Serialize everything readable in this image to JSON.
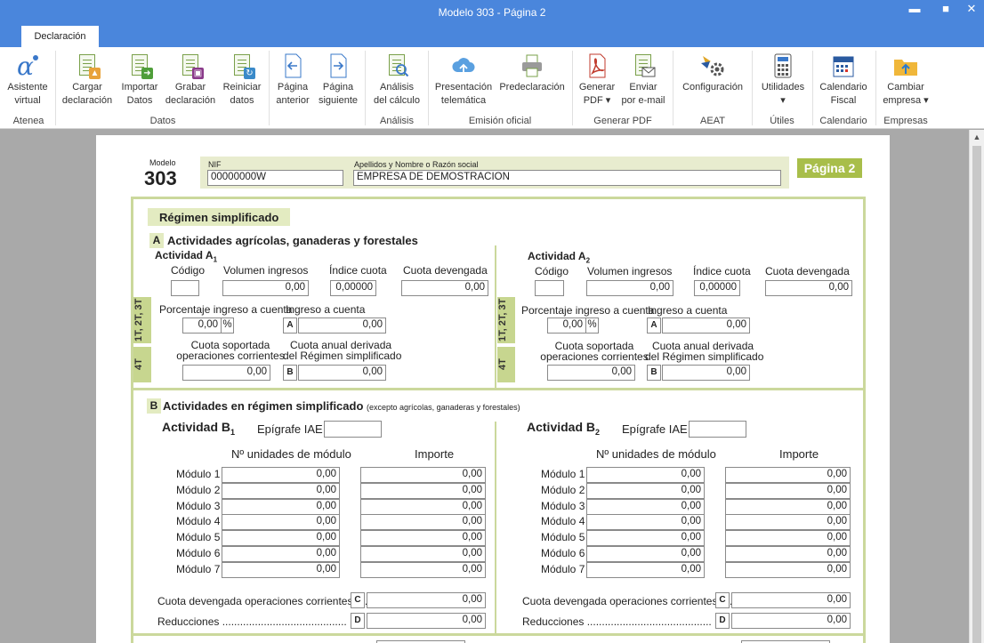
{
  "window": {
    "title": "Modelo 303 - Página 2",
    "controls": {
      "minimize": "▬",
      "maximize": "■",
      "close": "✕"
    }
  },
  "tabs": [
    {
      "label": "Declaración"
    }
  ],
  "ribbon": {
    "buttons": [
      {
        "id": "asistente",
        "label": "Asistente\nvirtual",
        "icon": "atenea-icon"
      },
      {
        "id": "cargar",
        "label": "Cargar\ndeclaración",
        "icon": "load-doc-icon"
      },
      {
        "id": "importar",
        "label": "Importar\nDatos",
        "icon": "import-doc-icon"
      },
      {
        "id": "grabar",
        "label": "Grabar\ndeclaración",
        "icon": "save-doc-icon"
      },
      {
        "id": "reiniciar",
        "label": "Reiniciar\ndatos",
        "icon": "reset-doc-icon"
      },
      {
        "id": "anterior",
        "label": "Página\nanterior",
        "icon": "prev-page-icon"
      },
      {
        "id": "siguiente",
        "label": "Página\nsiguiente",
        "icon": "next-page-icon"
      },
      {
        "id": "analisis",
        "label": "Análisis\ndel cálculo",
        "icon": "analysis-icon"
      },
      {
        "id": "presentacion",
        "label": "Presentación\ntelemática",
        "icon": "cloud-upload-icon"
      },
      {
        "id": "predeclaracion",
        "label": "Predeclaración",
        "icon": "printer-icon"
      },
      {
        "id": "generarpdf",
        "label": "Generar\nPDF ▾",
        "icon": "pdf-icon"
      },
      {
        "id": "enviar",
        "label": "Enviar\npor e-mail",
        "icon": "email-doc-icon"
      },
      {
        "id": "configuracion",
        "label": "Configuración",
        "icon": "gear-icon"
      },
      {
        "id": "utilidades",
        "label": "Utilidades\n▾",
        "icon": "calculator-icon"
      },
      {
        "id": "calendario",
        "label": "Calendario\nFiscal",
        "icon": "calendar-icon"
      },
      {
        "id": "cambiar",
        "label": "Cambiar\nempresa ▾",
        "icon": "folder-upload-icon"
      }
    ],
    "groups": [
      "Atenea",
      "Datos",
      "Análisis",
      "Emisión oficial",
      "Generar PDF",
      "AEAT",
      "Útiles",
      "Calendario",
      "Empresas"
    ]
  },
  "form": {
    "modelo_label": "Modelo",
    "modelo_num": "303",
    "nif_label": "NIF",
    "nif_value": "00000000W",
    "nombre_label": "Apellidos y Nombre o Razón social",
    "nombre_value": "EMPRESA DE DEMOSTRACION",
    "pagina": "Página 2",
    "regimen_title": "Régimen simplificado",
    "sectionA": {
      "letter": "A",
      "title": "Actividades agrícolas, ganaderas y forestales",
      "strip_top": "1T, 2T, 3T",
      "strip_bottom": "4T",
      "actividades": [
        {
          "title": "Actividad A",
          "sub": "1",
          "codigo_label": "Código",
          "codigo": "",
          "volumen_label": "Volumen ingresos",
          "volumen": "0,00",
          "indice_label": "Índice cuota",
          "indice": "0,00000",
          "cuota_label": "Cuota devengada",
          "cuota": "0,00",
          "porc_label": "Porcentaje ingreso a cuenta",
          "porc": "0,00",
          "pct": "%",
          "ingreso_label": "Ingreso a cuenta",
          "ingreso_letter": "A",
          "ingreso": "0,00",
          "soportada_label1": "Cuota soportada",
          "soportada_label2": "operaciones corrientes",
          "soportada": "0,00",
          "anual_label1": "Cuota anual derivada",
          "anual_label2": "del Régimen simplificado",
          "anual_letter": "B",
          "anual": "0,00"
        },
        {
          "title": "Actividad A",
          "sub": "2",
          "codigo_label": "Código",
          "codigo": "",
          "volumen_label": "Volumen ingresos",
          "volumen": "0,00",
          "indice_label": "Índice cuota",
          "indice": "0,00000",
          "cuota_label": "Cuota devengada",
          "cuota": "0,00",
          "porc_label": "Porcentaje ingreso a cuenta",
          "porc": "0,00",
          "pct": "%",
          "ingreso_label": "Ingreso a cuenta",
          "ingreso_letter": "A",
          "ingreso": "0,00",
          "soportada_label1": "Cuota soportada",
          "soportada_label2": "operaciones corrientes",
          "soportada": "0,00",
          "anual_label1": "Cuota anual derivada",
          "anual_label2": "del Régimen simplificado",
          "anual_letter": "B",
          "anual": "0,00"
        }
      ]
    },
    "sectionB": {
      "letter": "B",
      "title": "Actividades en régimen simplificado",
      "subtitle": "(excepto agrícolas, ganaderas y forestales)",
      "actividades": [
        {
          "title": "Actividad B",
          "sub": "1",
          "epigrafe_label": "Epígrafe IAE",
          "epigrafe": "",
          "unidades_label": "Nº unidades de módulo",
          "importe_label": "Importe",
          "modulos": [
            {
              "label": "Módulo 1",
              "unidades": "0,00",
              "importe": "0,00"
            },
            {
              "label": "Módulo 2",
              "unidades": "0,00",
              "importe": "0,00"
            },
            {
              "label": "Módulo 3",
              "unidades": "0,00",
              "importe": "0,00"
            },
            {
              "label": "Módulo 4",
              "unidades": "0,00",
              "importe": "0,00"
            },
            {
              "label": "Módulo 5",
              "unidades": "0,00",
              "importe": "0,00"
            },
            {
              "label": "Módulo 6",
              "unidades": "0,00",
              "importe": "0,00"
            },
            {
              "label": "Módulo 7",
              "unidades": "0,00",
              "importe": "0,00"
            }
          ],
          "cuota_label": "Cuota devengada operaciones corrientes .....",
          "cuota_letter": "C",
          "cuota": "0,00",
          "reducciones_label": "Reducciones ..........................................",
          "reducciones_letter": "D",
          "reducciones": "0,00"
        },
        {
          "title": "Actividad B",
          "sub": "2",
          "epigrafe_label": "Epígrafe IAE",
          "epigrafe": "",
          "unidades_label": "Nº unidades de módulo",
          "importe_label": "Importe",
          "modulos": [
            {
              "label": "Módulo 1",
              "unidades": "0,00",
              "importe": "0,00"
            },
            {
              "label": "Módulo 2",
              "unidades": "0,00",
              "importe": "0,00"
            },
            {
              "label": "Módulo 3",
              "unidades": "0,00",
              "importe": "0,00"
            },
            {
              "label": "Módulo 4",
              "unidades": "0,00",
              "importe": "0,00"
            },
            {
              "label": "Módulo 5",
              "unidades": "0,00",
              "importe": "0,00"
            },
            {
              "label": "Módulo 6",
              "unidades": "0,00",
              "importe": "0,00"
            },
            {
              "label": "Módulo 7",
              "unidades": "0,00",
              "importe": "0,00"
            }
          ],
          "cuota_label": "Cuota devengada operaciones corrientes .....",
          "cuota_letter": "C",
          "cuota": "0,00",
          "reducciones_label": "Reducciones ..........................................",
          "reducciones_letter": "D",
          "reducciones": "0,00"
        }
      ]
    }
  }
}
